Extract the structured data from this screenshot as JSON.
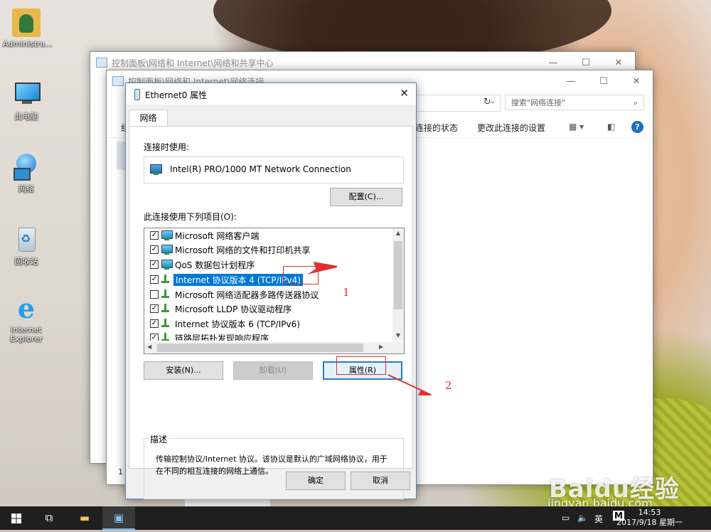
{
  "desktop": {
    "icons": [
      {
        "label": "Administra...",
        "icon": "user-folder-icon"
      },
      {
        "label": "此电脑",
        "icon": "computer-icon"
      },
      {
        "label": "网络",
        "icon": "network-icon"
      },
      {
        "label": "回收站",
        "icon": "recycle-bin-icon"
      },
      {
        "label": "Internet Explorer",
        "icon": "internet-explorer-icon"
      }
    ]
  },
  "window_back": {
    "title": "控制面板\\网络和 Internet\\网络和共享中心",
    "controls": {
      "minimize": "—",
      "maximize": "☐",
      "close": "✕"
    }
  },
  "window_mid": {
    "title": "控制面板\\网络和 Internet\\网络连接",
    "controls": {
      "minimize": "—",
      "maximize": "☐",
      "close": "✕"
    },
    "search_placeholder": "搜索\"网络连接\"",
    "cmd_status": "连接的状态",
    "cmd_change": "更改此连接的设置",
    "left_cut": "组",
    "status_count": "1"
  },
  "dialog": {
    "title": "Ethernet0 属性",
    "close": "✕",
    "tab": "网络",
    "connect_using_label": "连接时使用:",
    "adapter_name": "Intel(R) PRO/1000 MT Network Connection",
    "configure_button": "配置(C)...",
    "items_label": "此连接使用下列项目(O):",
    "items": [
      {
        "label": "Microsoft 网络客户端",
        "checked": true,
        "icon": "monitor"
      },
      {
        "label": "Microsoft 网络的文件和打印机共享",
        "checked": true,
        "icon": "monitor"
      },
      {
        "label": "QoS 数据包计划程序",
        "checked": true,
        "icon": "monitor"
      },
      {
        "label": "Internet 协议版本 4 (TCP/IPv4)",
        "checked": true,
        "icon": "green",
        "selected": true
      },
      {
        "label": "Microsoft 网络适配器多路传送器协议",
        "checked": false,
        "icon": "green"
      },
      {
        "label": "Microsoft LLDP 协议驱动程序",
        "checked": true,
        "icon": "green"
      },
      {
        "label": "Internet 协议版本 6 (TCP/IPv6)",
        "checked": true,
        "icon": "green"
      },
      {
        "label": "链路层拓扑发现响应程序",
        "checked": true,
        "icon": "green"
      }
    ],
    "install_button": "安装(N)...",
    "uninstall_button": "卸载(U)",
    "properties_button": "属性(R)",
    "description_label": "描述",
    "description_text": "传输控制协议/Internet 协议。该协议是默认的广域网络协议，用于在不同的相互连接的网络上通信。",
    "ok_button": "确定",
    "cancel_button": "取消"
  },
  "annotations": {
    "one": "1",
    "two": "2",
    "color": "#e03030"
  },
  "taskbar": {
    "lang": "英",
    "ime": "M",
    "time": "14:53",
    "date": "2017/9/18 星期一"
  },
  "watermark": {
    "brand": "Baidu经验",
    "url": "jingyan.baidu.com"
  }
}
